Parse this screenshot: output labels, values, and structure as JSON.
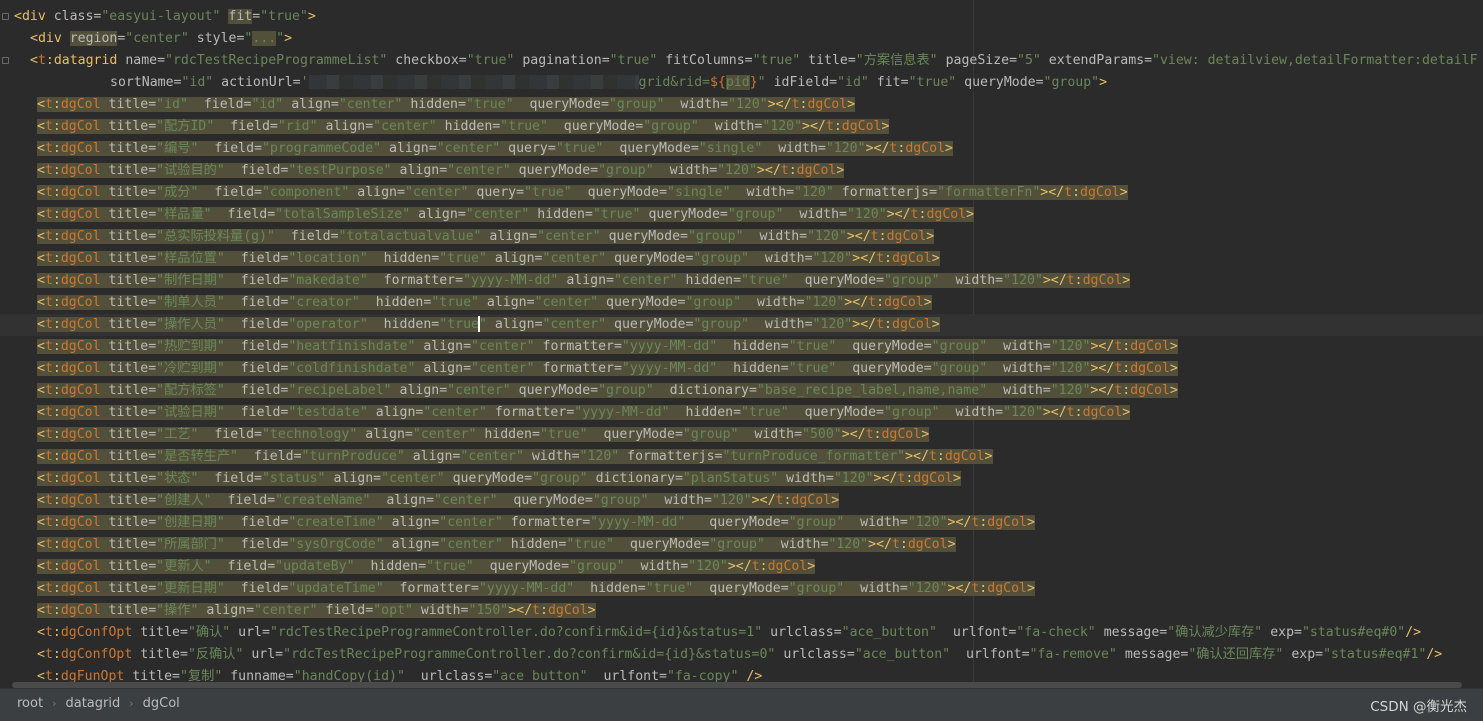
{
  "editor": {
    "lines": [
      {
        "indent": 0,
        "fold": true,
        "parts": [
          [
            "t",
            "<"
          ],
          [
            "t",
            "div "
          ],
          [
            "a",
            "class="
          ],
          [
            "v",
            "\"easyui-layout\" "
          ],
          [
            "ah",
            "fit"
          ],
          [
            "a",
            "="
          ],
          [
            "v",
            "\"true\""
          ],
          [
            "t",
            ">"
          ]
        ]
      },
      {
        "indent": 2,
        "fold": false,
        "parts": [
          [
            "t",
            "<div "
          ],
          [
            "ah",
            "region"
          ],
          [
            "a",
            "="
          ],
          [
            "v",
            "\"center\" "
          ],
          [
            "a",
            "style="
          ],
          [
            "v",
            "\""
          ],
          [
            "vh",
            "..."
          ],
          [
            "v",
            "\""
          ],
          [
            "t",
            ">"
          ]
        ]
      },
      {
        "indent": 2,
        "fold": true,
        "parts": [
          [
            "t",
            "<"
          ],
          [
            "tp",
            "t"
          ],
          [
            "t",
            ":datagrid "
          ],
          [
            "a",
            "name="
          ],
          [
            "v",
            "\"rdcTestRecipeProgrammeList\" "
          ],
          [
            "a",
            "checkbox="
          ],
          [
            "v",
            "\"true\" "
          ],
          [
            "a",
            "pagination="
          ],
          [
            "v",
            "\"true\" "
          ],
          [
            "a",
            "fitColumns="
          ],
          [
            "v",
            "\"true\" "
          ],
          [
            "a",
            "title="
          ],
          [
            "v",
            "\"方案信息表\" "
          ],
          [
            "a",
            "pageSize="
          ],
          [
            "v",
            "\"5\" "
          ],
          [
            "a",
            "extendParams="
          ],
          [
            "v",
            "\"view: detailview,detailFormatter:detailF"
          ]
        ]
      },
      {
        "indent": 12,
        "fold": false,
        "parts": [
          [
            "a",
            "sortName="
          ],
          [
            "v",
            "\"id\" "
          ],
          [
            "a",
            "actionUrl="
          ],
          [
            "v",
            "'"
          ],
          [
            "redact",
            ""
          ],
          [
            "v",
            "grid&rid="
          ],
          [
            "tp",
            "${"
          ],
          [
            "vh",
            "pid"
          ],
          [
            "tp",
            "}"
          ],
          [
            "v",
            "\" "
          ],
          [
            "a",
            "idField="
          ],
          [
            "v",
            "\"id\" "
          ],
          [
            "a",
            "fit="
          ],
          [
            "v",
            "\"true\" "
          ],
          [
            "a",
            "queryMode="
          ],
          [
            "v",
            "\"group\""
          ],
          [
            "t",
            ">"
          ]
        ]
      },
      {
        "hl": true,
        "text": "<t:dgCol title=\"id\"  field=\"id\" align=\"center\" hidden=\"true\"  queryMode=\"group\"  width=\"120\"></t:dgCol>"
      },
      {
        "hl": true,
        "text": "<t:dgCol title=\"配方ID\"  field=\"rid\" align=\"center\" hidden=\"true\"  queryMode=\"group\"  width=\"120\"></t:dgCol>"
      },
      {
        "hl": true,
        "text": "<t:dgCol title=\"编号\"  field=\"programmeCode\" align=\"center\" query=\"true\"  queryMode=\"single\"  width=\"120\"></t:dgCol>"
      },
      {
        "hl": true,
        "text": "<t:dgCol title=\"试验目的\"  field=\"testPurpose\" align=\"center\" queryMode=\"group\"  width=\"120\"></t:dgCol>"
      },
      {
        "hl": true,
        "text": "<t:dgCol title=\"成分\"  field=\"component\" align=\"center\" query=\"true\"  queryMode=\"single\"  width=\"120\" formatterjs=\"formatterFn\"></t:dgCol>"
      },
      {
        "hl": true,
        "text": "<t:dgCol title=\"样品量\"  field=\"totalSampleSize\" align=\"center\" hidden=\"true\" queryMode=\"group\"  width=\"120\"></t:dgCol>"
      },
      {
        "hl": true,
        "text": "<t:dgCol title=\"总实际投料量(g)\"  field=\"totalactualvalue\" align=\"center\" queryMode=\"group\"  width=\"120\"></t:dgCol>"
      },
      {
        "hl": true,
        "text": "<t:dgCol title=\"样品位置\"  field=\"location\"  hidden=\"true\" align=\"center\" queryMode=\"group\"  width=\"120\"></t:dgCol>"
      },
      {
        "hl": true,
        "text": "<t:dgCol title=\"制作日期\"  field=\"makedate\"  formatter=\"yyyy-MM-dd\" align=\"center\" hidden=\"true\"  queryMode=\"group\"  width=\"120\"></t:dgCol>"
      },
      {
        "hl": true,
        "text": "<t:dgCol title=\"制单人员\"  field=\"creator\"  hidden=\"true\" align=\"center\" queryMode=\"group\"  width=\"120\"></t:dgCol>"
      },
      {
        "hl": true,
        "current": true,
        "caret": true,
        "text": "<t:dgCol title=\"操作人员\"  field=\"operator\"  hidden=\"true\" align=\"center\" queryMode=\"group\"  width=\"120\"></t:dgCol>"
      },
      {
        "hl": true,
        "text": "<t:dgCol title=\"热贮到期\"  field=\"heatfinishdate\" align=\"center\" formatter=\"yyyy-MM-dd\"  hidden=\"true\"  queryMode=\"group\"  width=\"120\"></t:dgCol>"
      },
      {
        "hl": true,
        "text": "<t:dgCol title=\"冷贮到期\"  field=\"coldfinishdate\" align=\"center\" formatter=\"yyyy-MM-dd\"  hidden=\"true\"  queryMode=\"group\"  width=\"120\"></t:dgCol>"
      },
      {
        "hl": true,
        "text": "<t:dgCol title=\"配方标签\"  field=\"recipeLabel\" align=\"center\" queryMode=\"group\"  dictionary=\"base_recipe_label,name,name\"  width=\"120\"></t:dgCol>"
      },
      {
        "hl": true,
        "text": "<t:dgCol title=\"试验日期\"  field=\"testdate\" align=\"center\" formatter=\"yyyy-MM-dd\"  hidden=\"true\"  queryMode=\"group\"  width=\"120\"></t:dgCol>"
      },
      {
        "hl": true,
        "text": "<t:dgCol title=\"工艺\"  field=\"technology\" align=\"center\" hidden=\"true\"  queryMode=\"group\"  width=\"500\"></t:dgCol>"
      },
      {
        "hl": true,
        "text": "<t:dgCol title=\"是否转生产\"  field=\"turnProduce\" align=\"center\" width=\"120\" formatterjs=\"turnProduce_formatter\"></t:dgCol>"
      },
      {
        "hl": true,
        "text": "<t:dgCol title=\"状态\"  field=\"status\" align=\"center\" queryMode=\"group\" dictionary=\"planStatus\" width=\"120\"></t:dgCol>"
      },
      {
        "hl": true,
        "text": "<t:dgCol title=\"创建人\"  field=\"createName\"  align=\"center\"  queryMode=\"group\"  width=\"120\"></t:dgCol>"
      },
      {
        "hl": true,
        "text": "<t:dgCol title=\"创建日期\"  field=\"createTime\" align=\"center\" formatter=\"yyyy-MM-dd\"   queryMode=\"group\"  width=\"120\"></t:dgCol>"
      },
      {
        "hl": true,
        "text": "<t:dgCol title=\"所属部门\"  field=\"sysOrgCode\" align=\"center\" hidden=\"true\"  queryMode=\"group\"  width=\"120\"></t:dgCol>"
      },
      {
        "hl": true,
        "text": "<t:dgCol title=\"更新人\"  field=\"updateBy\"  hidden=\"true\"  queryMode=\"group\"  width=\"120\"></t:dgCol>"
      },
      {
        "hl": true,
        "text": "<t:dgCol title=\"更新日期\"  field=\"updateTime\"  formatter=\"yyyy-MM-dd\"  hidden=\"true\"  queryMode=\"group\"  width=\"120\"></t:dgCol>"
      },
      {
        "hl": true,
        "text": "<t:dgCol title=\"操作\" align=\"center\" field=\"opt\" width=\"150\"></t:dgCol>"
      },
      {
        "hl": false,
        "text": "<t:dgConfOpt title=\"确认\" url=\"rdcTestRecipeProgrammeController.do?confirm&id={id}&status=1\" urlclass=\"ace_button\"  urlfont=\"fa-check\" message=\"确认减少库存\" exp=\"status#eq#0\"/>"
      },
      {
        "hl": false,
        "text": "<t:dgConfOpt title=\"反确认\" url=\"rdcTestRecipeProgrammeController.do?confirm&id={id}&status=0\" urlclass=\"ace_button\"  urlfont=\"fa-remove\" message=\"确认还回库存\" exp=\"status#eq#1\"/>"
      },
      {
        "hl": false,
        "text": "<t:dgFunOpt title=\"复制\" funname=\"handCopy(id)\"  urlclass=\"ace_button\"  urlfont=\"fa-copy\" />"
      }
    ]
  },
  "statusbar": {
    "breadcrumbs": [
      "root",
      "datagrid",
      "dgCol"
    ],
    "watermark": "CSDN @衡光杰"
  }
}
